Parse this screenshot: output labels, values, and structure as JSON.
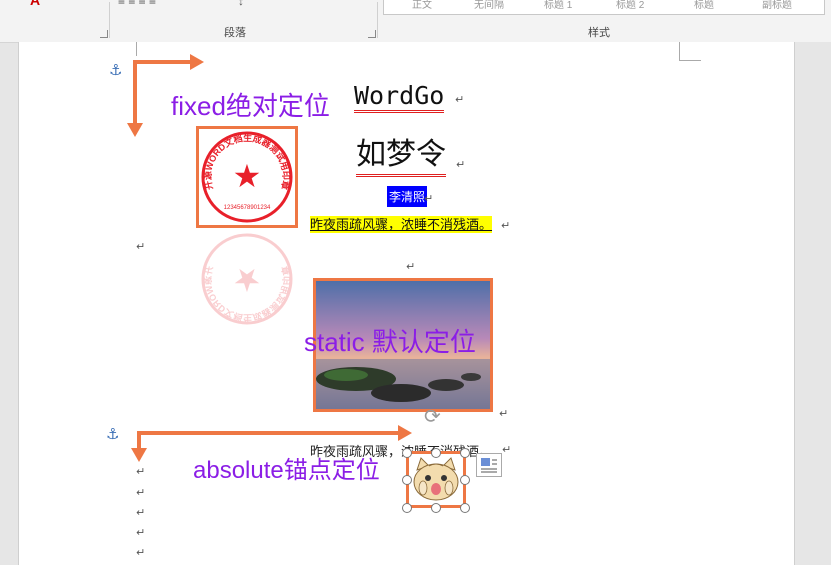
{
  "ribbon": {
    "paragraph_group_label": "段落",
    "styles_group_label": "样式",
    "style_items": [
      "正文",
      "无间隔",
      "标题 1",
      "标题 2",
      "标题",
      "副标题"
    ]
  },
  "document": {
    "title": "WordGo",
    "poem_title": "如梦令",
    "author": "李清照",
    "line1": "昨夜雨疏风骤，浓睡不消残酒。",
    "line2": "昨夜雨疏风骤，浓睡不消残酒。",
    "para_mark": "↵",
    "seal_text": "开源WORD文档生成器测试用印章",
    "seal_number": "12345678901234"
  },
  "annotations": {
    "fixed": "fixed绝对定位",
    "static": "static 默认定位",
    "absolute": "absolute锚点定位"
  },
  "icons": {
    "anchor": "⚓",
    "rotate": "⟳",
    "star": "★"
  },
  "colors": {
    "annotation_purple": "#8b1ee6",
    "arrow_orange": "#ee7744",
    "highlight_yellow": "#ffff00",
    "author_blue_bg": "#0000ff",
    "seal_red": "#e8202a",
    "underline_red": "#e02020"
  }
}
